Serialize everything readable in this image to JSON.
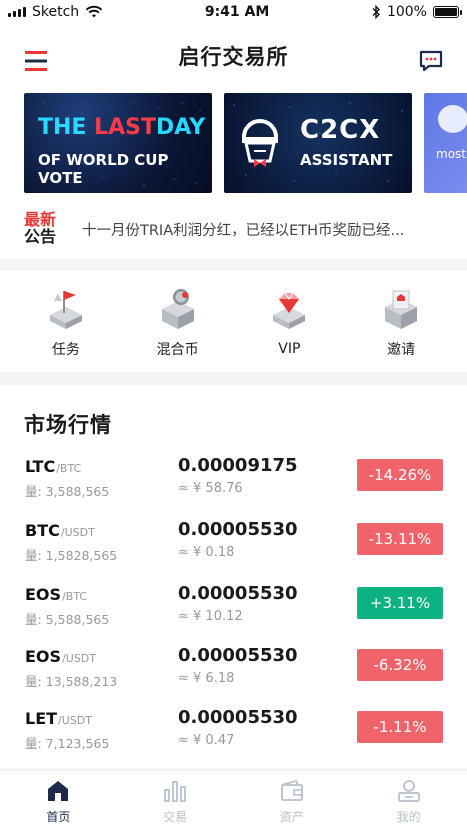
{
  "status_bar": {
    "carrier": "Sketch",
    "time": "9:41 AM",
    "battery": "100%"
  },
  "header": {
    "title": "启行交易所"
  },
  "banners": [
    {
      "line1_a": "THE ",
      "line1_b": "LAST",
      "line1_c": "DAY",
      "line2": "OF WORLD CUP VOTE"
    },
    {
      "title": "C2CX",
      "subtitle": "ASSISTANT"
    },
    {
      "text": "most"
    }
  ],
  "notice": {
    "badge_top": "最新",
    "badge_bottom": "公告",
    "text": "十一月份TRIA利润分红，已经以ETH币奖励已经..."
  },
  "features": [
    {
      "label": "任务",
      "icon": "task-icon"
    },
    {
      "label": "混合币",
      "icon": "mixcoin-icon"
    },
    {
      "label": "VIP",
      "icon": "vip-diamond-icon"
    },
    {
      "label": "邀请",
      "icon": "invite-icon"
    }
  ],
  "market": {
    "title": "市场行情",
    "rows": [
      {
        "base": "LTC",
        "quote": "/BTC",
        "volume": "量: 3,588,565",
        "price": "0.00009175",
        "fiat": "≈ ¥ 58.76",
        "change": "-14.26%",
        "direction": "down"
      },
      {
        "base": "BTC",
        "quote": "/USDT",
        "volume": "量: 1,5828,565",
        "price": "0.00005530",
        "fiat": "≈ ¥ 0.18",
        "change": "-13.11%",
        "direction": "down"
      },
      {
        "base": "EOS",
        "quote": "/BTC",
        "volume": "量: 5,588,565",
        "price": "0.00005530",
        "fiat": "≈ ¥ 10.12",
        "change": "+3.11%",
        "direction": "up"
      },
      {
        "base": "EOS",
        "quote": "/USDT",
        "volume": "量: 13,588,213",
        "price": "0.00005530",
        "fiat": "≈ ¥ 6.18",
        "change": "-6.32%",
        "direction": "down"
      },
      {
        "base": "LET",
        "quote": "/USDT",
        "volume": "量: 7,123,565",
        "price": "0.00005530",
        "fiat": "≈ ¥ 0.47",
        "change": "-1.11%",
        "direction": "down"
      }
    ]
  },
  "tabbar": {
    "items": [
      {
        "label": "首页",
        "icon": "home-icon",
        "active": true
      },
      {
        "label": "交易",
        "icon": "trade-chart-icon",
        "active": false
      },
      {
        "label": "资产",
        "icon": "wallet-icon",
        "active": false
      },
      {
        "label": "我的",
        "icon": "profile-icon",
        "active": false
      }
    ]
  },
  "colors": {
    "accent_red": "#e53935",
    "down": "#f1636a",
    "up": "#0db282",
    "tab_active": "#1b2b4a",
    "tab_inactive": "#b8c1cc"
  }
}
